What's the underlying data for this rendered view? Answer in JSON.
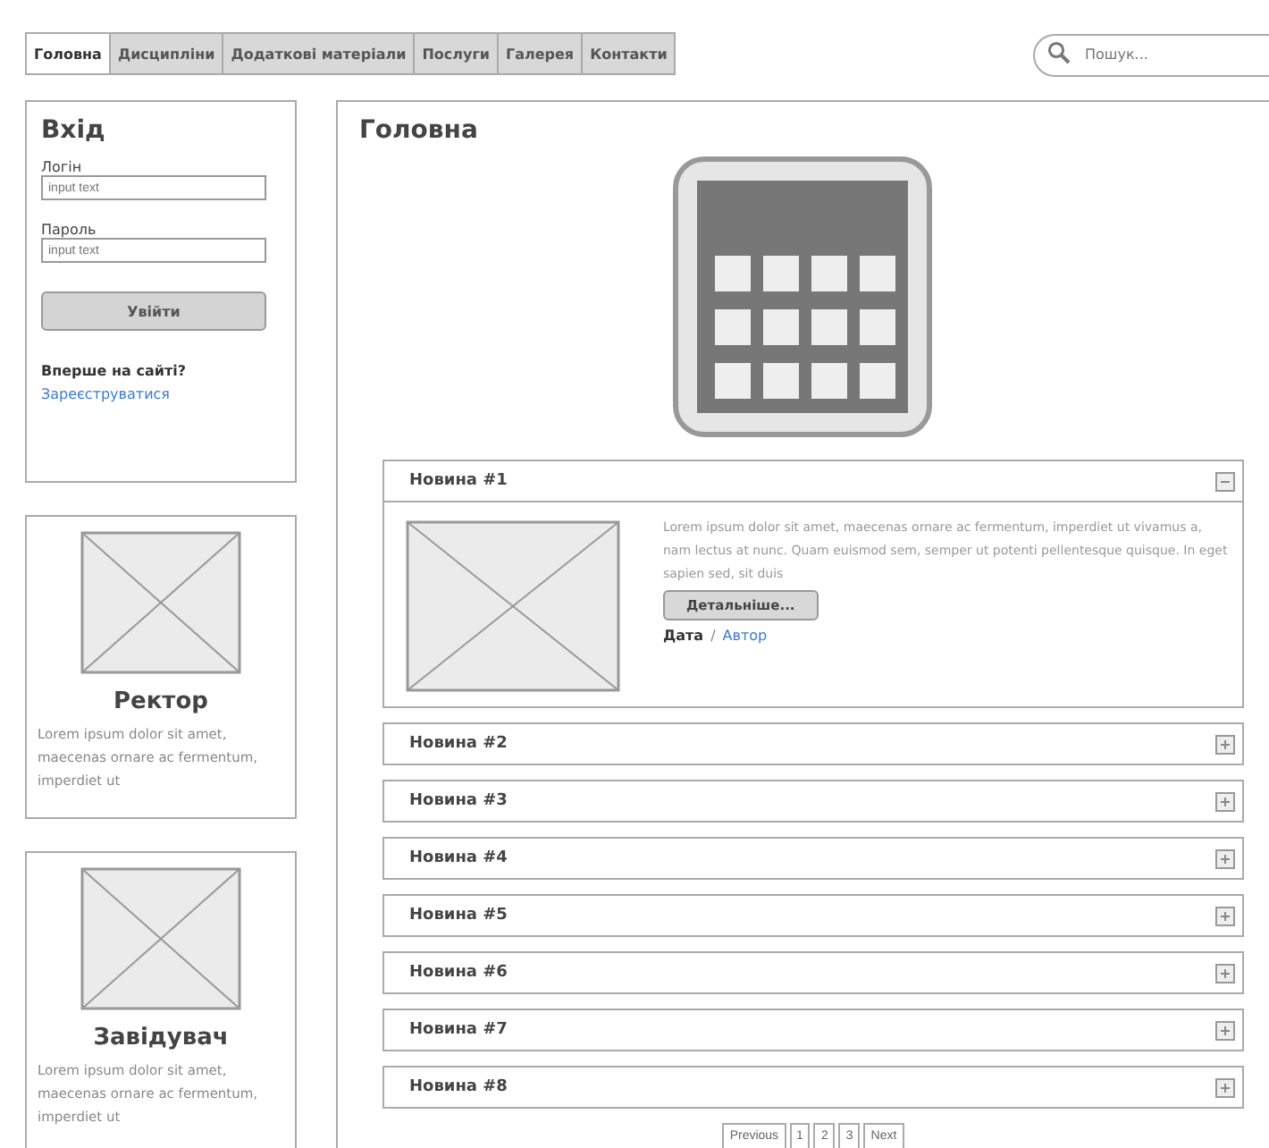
{
  "tabs": [
    {
      "label": "Головна",
      "selected": true
    },
    {
      "label": "Дисципліни",
      "selected": false
    },
    {
      "label": "Додаткові матеріали",
      "selected": false
    },
    {
      "label": "Послуги",
      "selected": false
    },
    {
      "label": "Галерея",
      "selected": false
    },
    {
      "label": "Контакти",
      "selected": false
    }
  ],
  "search": {
    "placeholder": "Пошук..."
  },
  "login": {
    "title": "Вхід",
    "fields": [
      {
        "label": "Логін",
        "placeholder": "input text"
      },
      {
        "label": "Пароль",
        "placeholder": "input text"
      }
    ],
    "button": "Увійти",
    "prompt": "Вперше на сайті?",
    "register_link": "Зареєструватися"
  },
  "people": [
    {
      "title": "Ректор",
      "text": "Lorem ipsum dolor sit amet, maecenas ornare ac fermentum, imperdiet ut"
    },
    {
      "title": "Завідувач",
      "text": "Lorem ipsum dolor sit amet, maecenas ornare ac fermentum, imperdiet ut"
    }
  ],
  "main": {
    "title": "Головна",
    "news": [
      {
        "title": "Новина #1",
        "expanded": true,
        "text": "Lorem ipsum dolor sit amet, maecenas ornare ac fermentum, imperdiet ut vivamus a, nam lectus at nunc. Quam euismod sem, semper ut potenti pellentesque quisque. In eget sapien sed, sit duis",
        "button": "Детальніше...",
        "date": "Дата",
        "separator": "/",
        "author": "Автор"
      },
      {
        "title": "Новина #2",
        "expanded": false
      },
      {
        "title": "Новина #3",
        "expanded": false
      },
      {
        "title": "Новина #4",
        "expanded": false
      },
      {
        "title": "Новина #5",
        "expanded": false
      },
      {
        "title": "Новина #6",
        "expanded": false
      },
      {
        "title": "Новина #7",
        "expanded": false
      },
      {
        "title": "Новина #8",
        "expanded": false
      }
    ],
    "pagination": [
      "Previous",
      "1",
      "2",
      "3",
      "Next"
    ]
  }
}
